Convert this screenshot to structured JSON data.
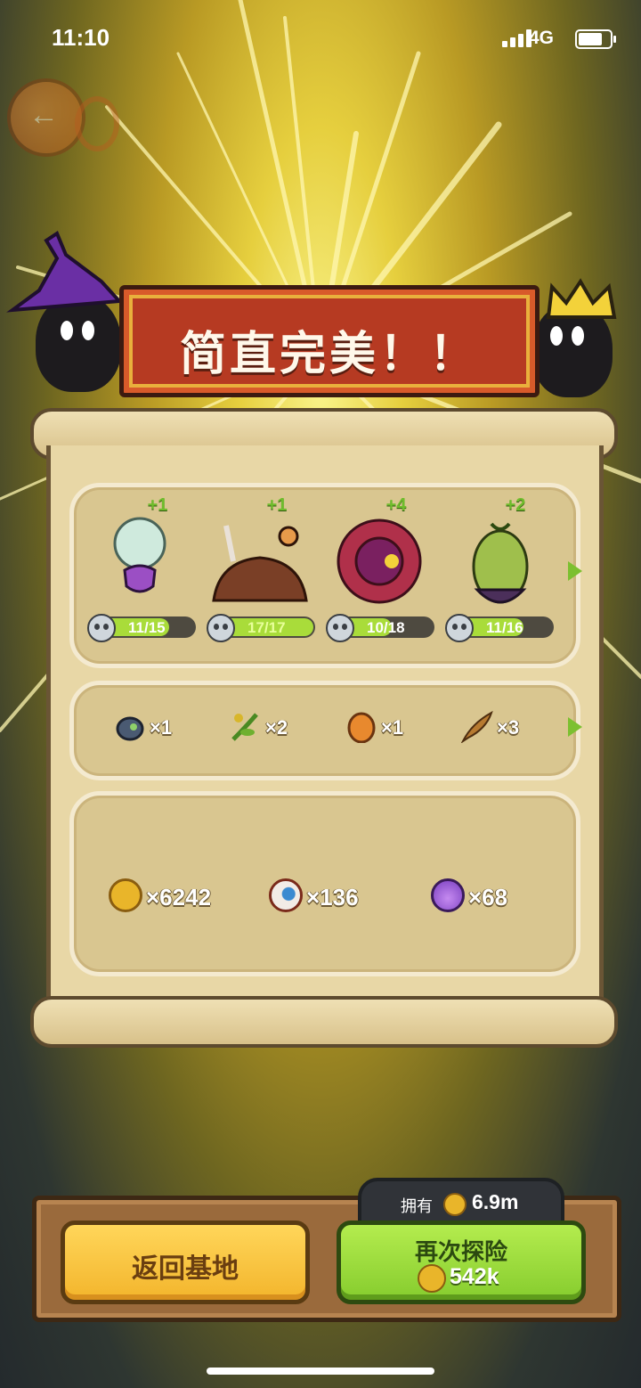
{
  "status_bar": {
    "time": "11:10",
    "network": "4G"
  },
  "banner": {
    "title": "简直完美！！"
  },
  "monsters": [
    {
      "plus": "+1",
      "level": "11/15",
      "progress": 0.73,
      "icon": "glass-dome-octopus-icon",
      "color": "#8a4bb8"
    },
    {
      "plus": "+1",
      "level": "17/17",
      "progress": 1.0,
      "icon": "candy-blob-icon",
      "color": "#6e3a22"
    },
    {
      "plus": "+4",
      "level": "10/18",
      "progress": 0.56,
      "icon": "eyeball-flower-icon",
      "color": "#b0304a"
    },
    {
      "plus": "+2",
      "level": "11/16",
      "progress": 0.69,
      "icon": "green-egg-creature-icon",
      "color": "#8fb040"
    }
  ],
  "items": [
    {
      "qty": "×1",
      "icon": "beetle-icon"
    },
    {
      "qty": "×2",
      "icon": "herb-icon"
    },
    {
      "qty": "×1",
      "icon": "egg-icon"
    },
    {
      "qty": "×3",
      "icon": "feather-icon"
    }
  ],
  "resources": [
    {
      "qty": "×6242",
      "icon": "gold-coin-icon"
    },
    {
      "qty": "×136",
      "icon": "eyeball-icon"
    },
    {
      "qty": "×68",
      "icon": "potion-icon"
    }
  ],
  "footer": {
    "owned_label": "拥有",
    "owned_value": "6.9m",
    "home_button": "返回基地",
    "explore_button": "再次探险",
    "explore_cost": "542k"
  },
  "colors": {
    "accent_green": "#8bd03a",
    "banner_red": "#b63a22",
    "gold": "#e9b52a"
  }
}
